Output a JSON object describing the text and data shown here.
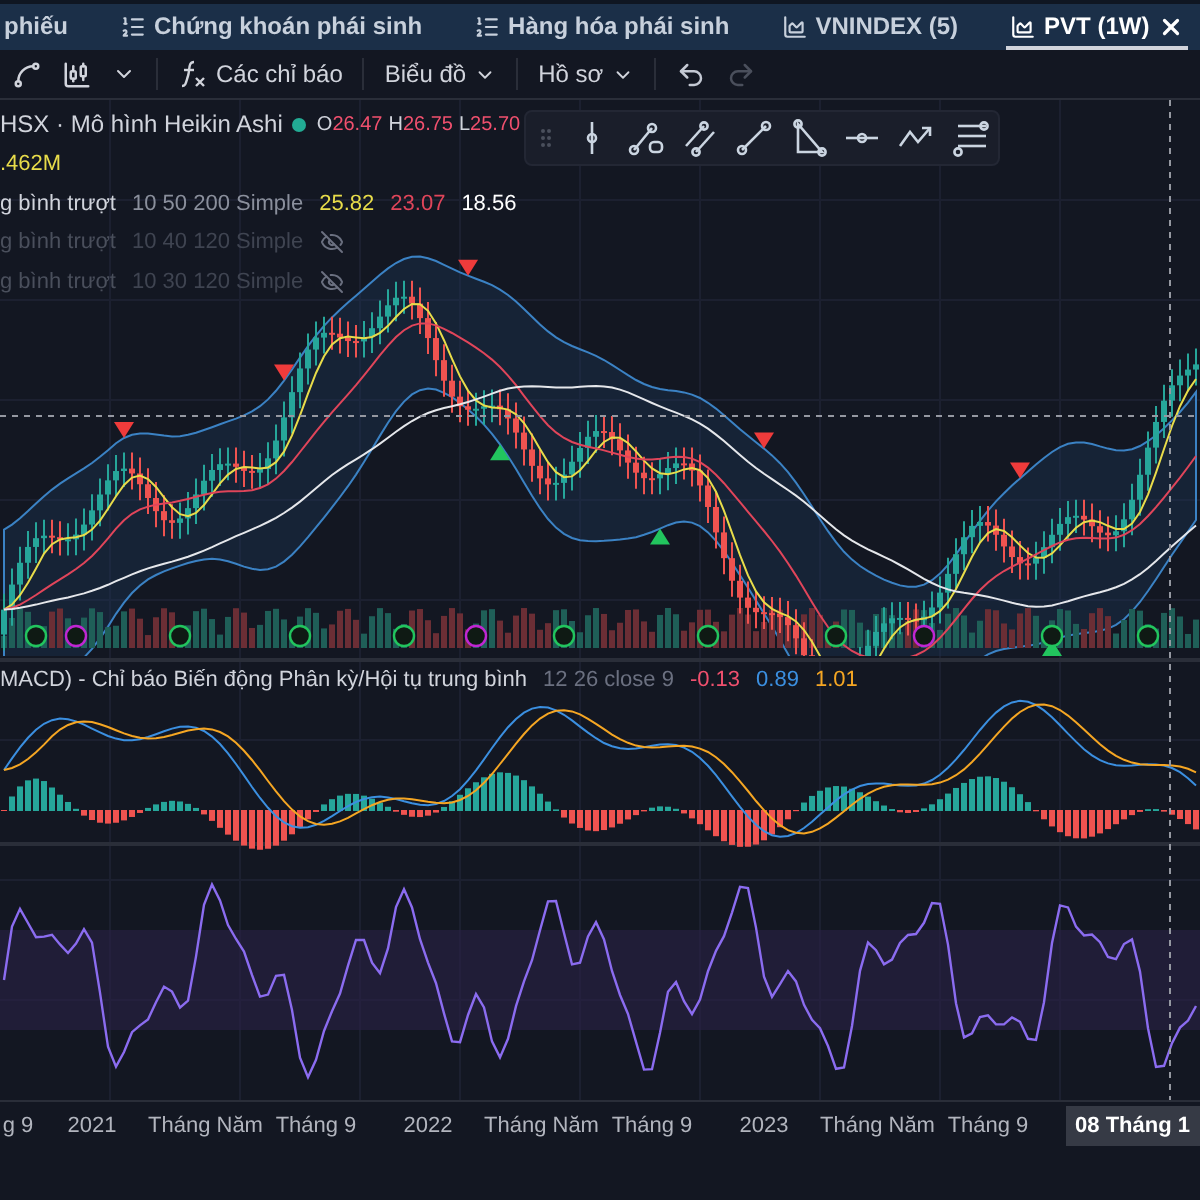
{
  "tabs": [
    {
      "label": "phiếu",
      "kind": "plain",
      "selected": false,
      "closable": false
    },
    {
      "label": "Chứng khoán phái sinh",
      "kind": "list",
      "selected": false,
      "closable": false
    },
    {
      "label": "Hàng hóa phái sinh",
      "kind": "list",
      "selected": false,
      "closable": false
    },
    {
      "label": "VNINDEX (5)",
      "kind": "chart",
      "selected": false,
      "closable": false
    },
    {
      "label": "PVT (1W)",
      "kind": "chart",
      "selected": true,
      "closable": true
    }
  ],
  "toolbar": {
    "indicators_button": "Các chỉ báo",
    "chart_menu": "Biểu đồ",
    "profile_menu": "Hồ sơ",
    "undo_disabled": false,
    "redo_disabled": true
  },
  "legend": {
    "title": "HSX · Mô hình Heikin Ashi",
    "ohlc": [
      {
        "label": "O",
        "value": "26.47"
      },
      {
        "label": "H",
        "value": "26.75"
      },
      {
        "label": "L",
        "value": "25.70"
      }
    ],
    "volume": ".462M",
    "indicators": [
      {
        "name": "g bình trượt",
        "params": "10 50 200 Simple",
        "hidden": false,
        "values": [
          {
            "text": "25.82",
            "color": "#e8dc4a"
          },
          {
            "text": "23.07",
            "color": "#e0455a"
          },
          {
            "text": "18.56",
            "color": "#ffffff"
          }
        ]
      },
      {
        "name": "g bình trượt",
        "params": "10 40 120 Simple",
        "hidden": true
      },
      {
        "name": "g bình trượt",
        "params": "10 30 120 Simple",
        "hidden": true
      }
    ]
  },
  "macd": {
    "name": "MACD) - Chỉ báo Biến động Phân kỳ/Hội tụ trung bình",
    "params": "12 26 close 9",
    "values": [
      {
        "text": "-0.13",
        "color": "#f0506e"
      },
      {
        "text": "0.89",
        "color": "#3b8fe0"
      },
      {
        "text": "1.01",
        "color": "#f5a623"
      }
    ]
  },
  "time_axis": [
    {
      "label": "g 9",
      "highlighted": false
    },
    {
      "label": "2021",
      "highlighted": false
    },
    {
      "label": "Tháng Năm",
      "highlighted": false
    },
    {
      "label": "Tháng 9",
      "highlighted": false
    },
    {
      "label": "2022",
      "highlighted": false
    },
    {
      "label": "Tháng Năm",
      "highlighted": false
    },
    {
      "label": "Tháng 9",
      "highlighted": false
    },
    {
      "label": "2023",
      "highlighted": false
    },
    {
      "label": "Tháng Năm",
      "highlighted": false
    },
    {
      "label": "Tháng 9",
      "highlighted": false
    },
    {
      "label": "08 Tháng 1",
      "highlighted": true
    }
  ]
}
